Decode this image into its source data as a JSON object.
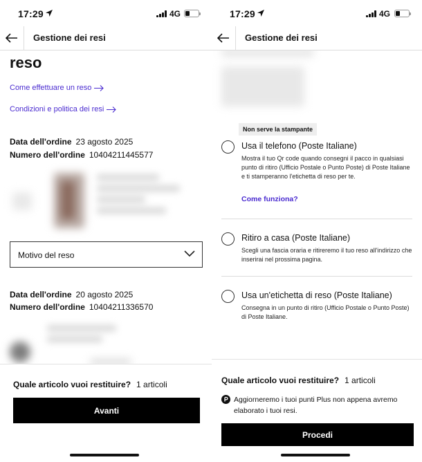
{
  "status": {
    "time": "17:29",
    "network": "4G"
  },
  "header": {
    "title": "Gestione dei resi"
  },
  "left": {
    "heading": "reso",
    "link_how": "Come effettuare un reso",
    "link_policy": "Condizioni e politica dei resi",
    "orders": [
      {
        "date_label": "Data dell'ordine",
        "date": "23 agosto 2025",
        "number_label": "Numero dell'ordine",
        "number": "10404211445577"
      },
      {
        "date_label": "Data dell'ordine",
        "date": "20 agosto 2025",
        "number_label": "Numero dell'ordine",
        "number": "10404211336570"
      }
    ],
    "reason_select": "Motivo del reso",
    "sheet_question": "Quale articolo vuoi restituire?",
    "sheet_count": "1 articoli",
    "button": "Avanti"
  },
  "right": {
    "badge": "Non serve la stampante",
    "options": [
      {
        "title": "Usa il telefono (Poste Italiane)",
        "desc": "Mostra il tuo Qr code quando consegni il pacco in qualsiasi punto di ritiro (Ufficio Postale o Punto Poste) di Poste Italiane e ti stamperanno l'etichetta di reso per te.",
        "link": "Come funziona?"
      },
      {
        "title": "Ritiro a casa (Poste Italiane)",
        "desc": "Scegli una fascia oraria e ritireremo il tuo reso all'indirizzo che inserirai nel prossima pagina."
      },
      {
        "title": "Usa un'etichetta di reso (Poste Italiane)",
        "desc": "Consegna in un punto di ritiro (Ufficio Postale o Punto Poste) di Poste Italiane."
      }
    ],
    "sheet_question": "Quale articolo vuoi restituire?",
    "sheet_count": "1 articoli",
    "plus_note": "Aggiorneremo i tuoi punti Plus non appena avremo elaborato i tuoi resi.",
    "button": "Procedi"
  }
}
